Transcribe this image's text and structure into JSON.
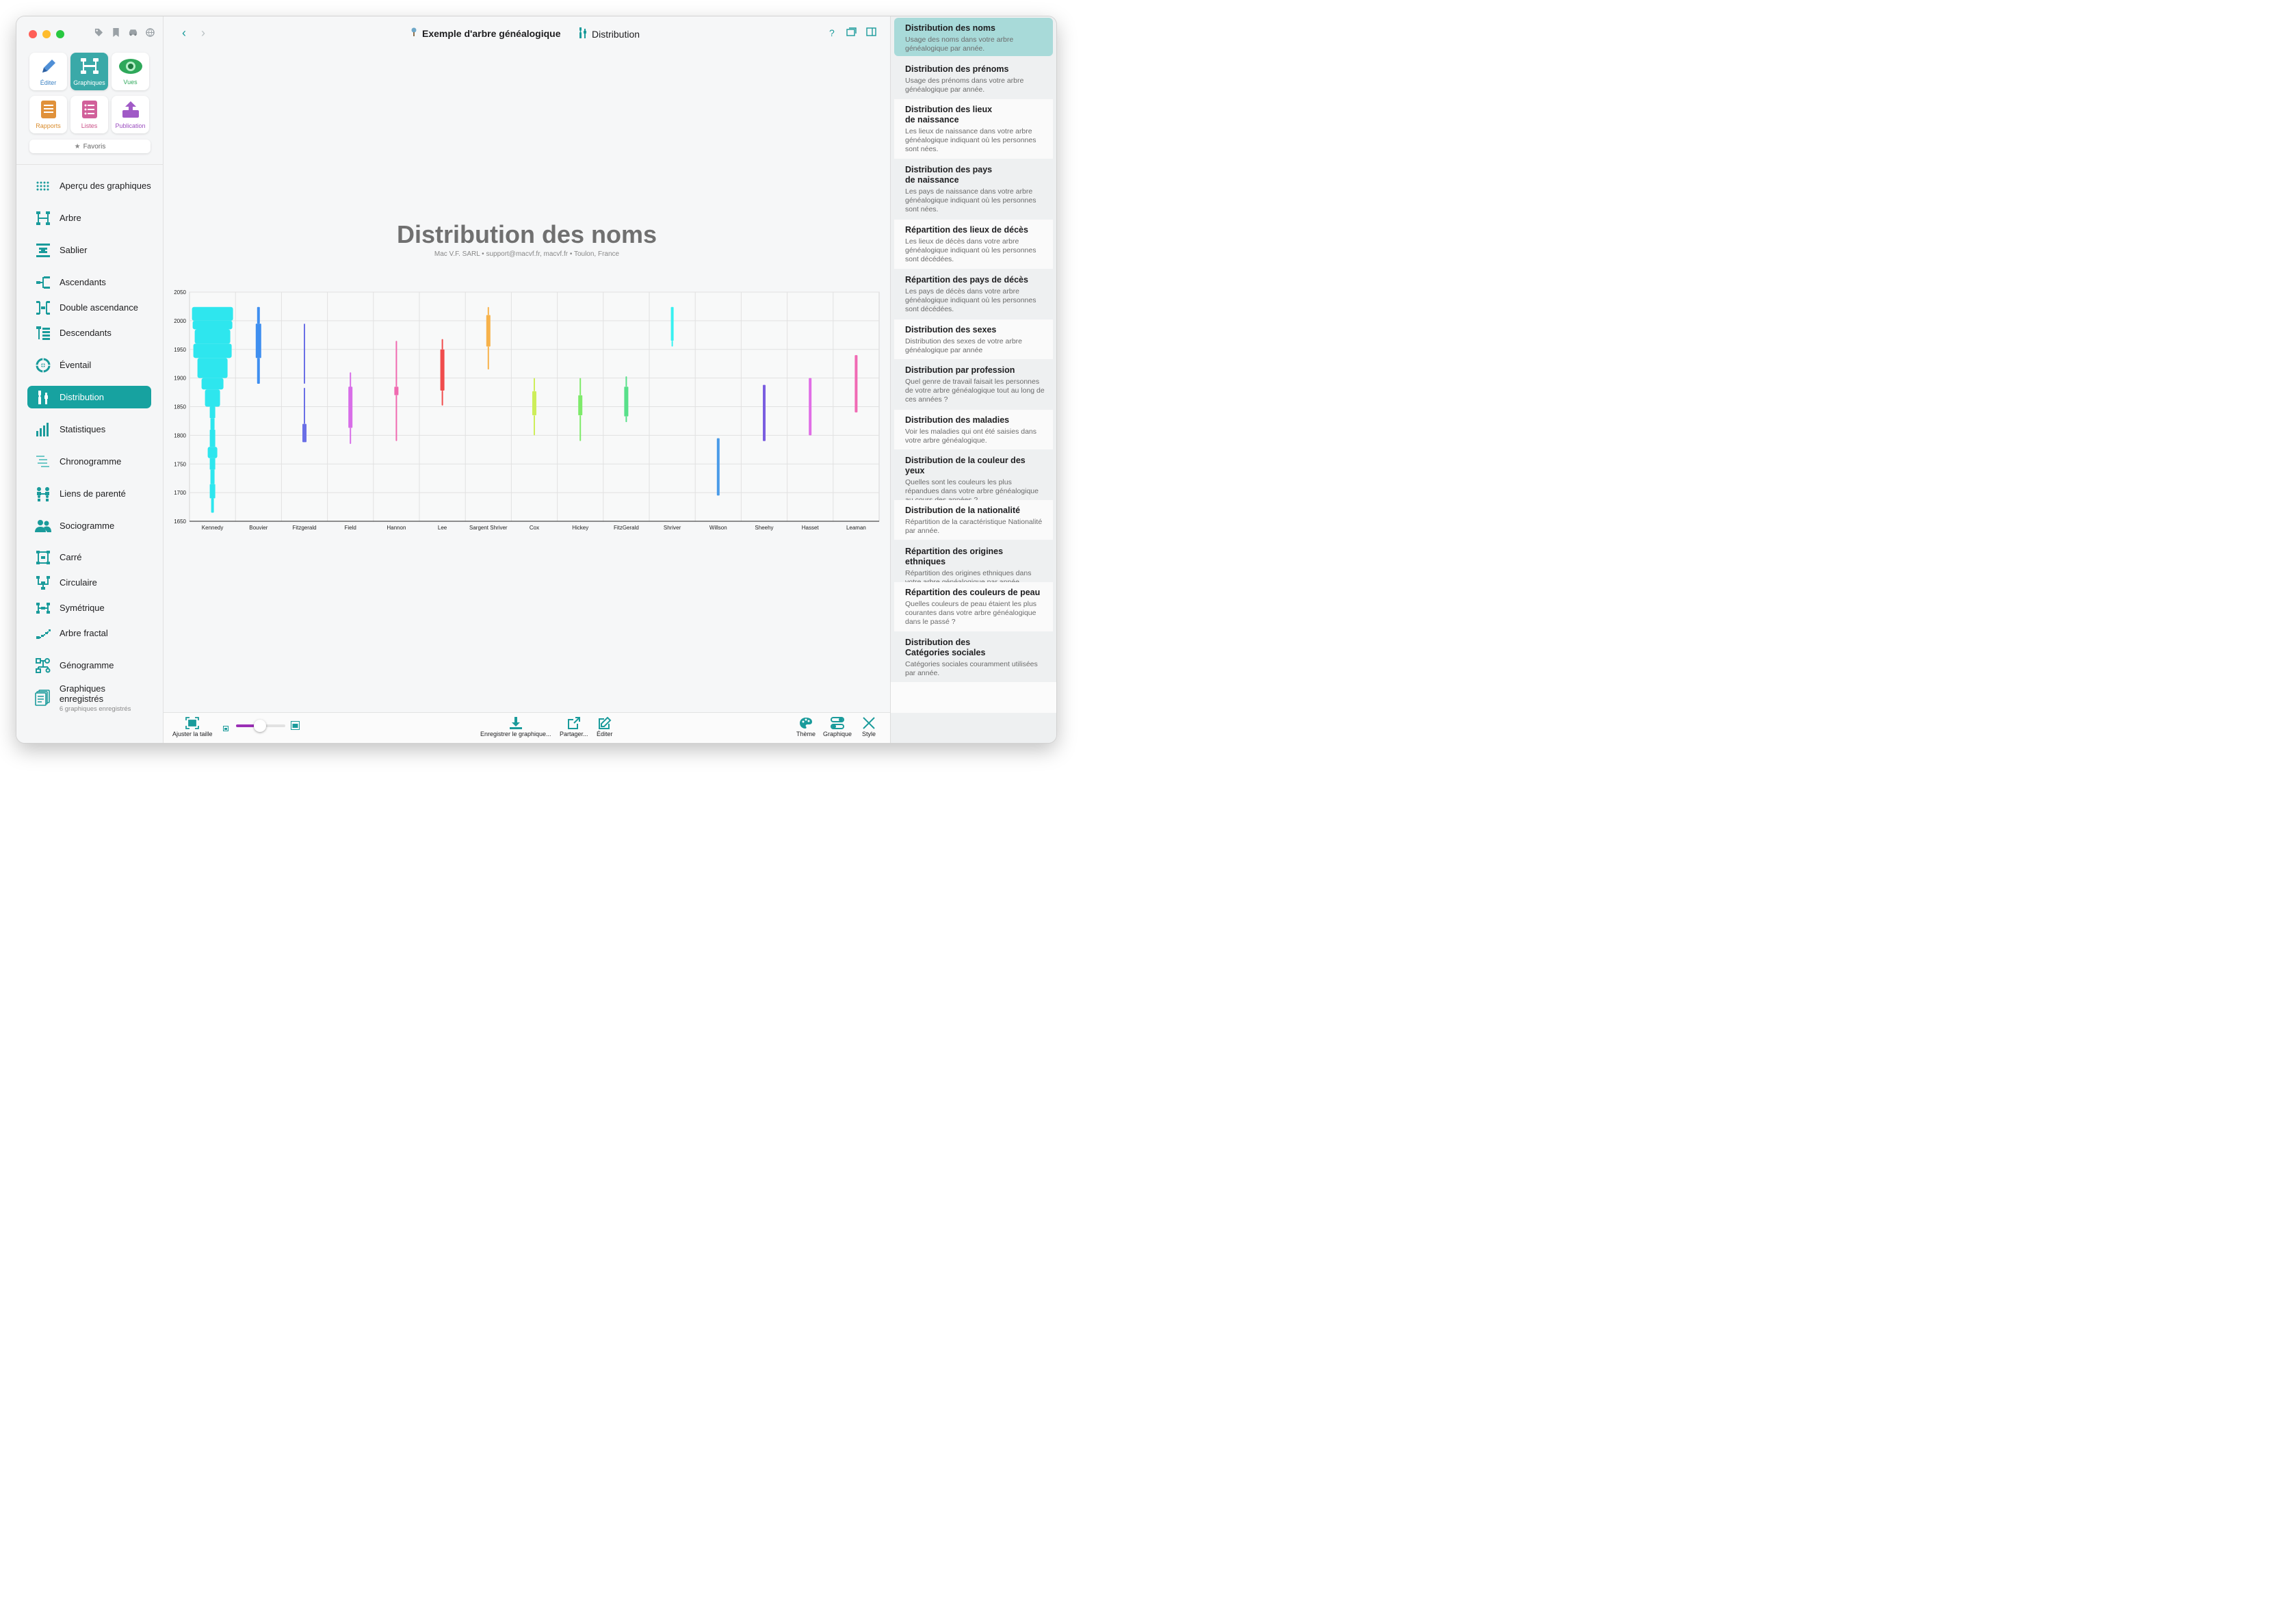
{
  "sidebar": {
    "window_controls_colors": [
      "#ff5f57",
      "#febc2e",
      "#28c840"
    ],
    "toolbar_icons": [
      "tag-icon",
      "bookmark-icon",
      "car-icon",
      "globe-icon"
    ],
    "tools": [
      {
        "label": "Éditer",
        "icon": "pencil-icon",
        "color": "#3b82c4"
      },
      {
        "label": "Graphiques",
        "icon": "chart-tree-icon",
        "color": "#ffffff"
      },
      {
        "label": "Vues",
        "icon": "eye-icon",
        "color": "#2ea85a"
      },
      {
        "label": "Rapports",
        "icon": "report-icon",
        "color": "#d98b2b"
      },
      {
        "label": "Listes",
        "icon": "list-icon",
        "color": "#c94e86"
      },
      {
        "label": "Publication",
        "icon": "upload-icon",
        "color": "#9b4dbf"
      }
    ],
    "favorites_label": "Favoris",
    "nav": [
      {
        "label": "Aperçu des graphiques",
        "icon": "grid-dots-icon"
      },
      {
        "label": "Arbre",
        "icon": "tree-icon"
      },
      {
        "label": "Sablier",
        "icon": "hourglass-icon"
      },
      {
        "label": "Ascendants",
        "icon": "ancestors-icon"
      },
      {
        "label": "Double ascendance",
        "icon": "double-ancestry-icon"
      },
      {
        "label": "Descendants",
        "icon": "descendants-icon"
      },
      {
        "label": "Éventail",
        "icon": "fan-icon"
      },
      {
        "label": "Distribution",
        "icon": "distribution-icon"
      },
      {
        "label": "Statistiques",
        "icon": "statistics-icon"
      },
      {
        "label": "Chronogramme",
        "icon": "timeline-icon"
      },
      {
        "label": "Liens de parenté",
        "icon": "relationship-icon"
      },
      {
        "label": "Sociogramme",
        "icon": "people-icon"
      },
      {
        "label": "Carré",
        "icon": "square-chart-icon"
      },
      {
        "label": "Circulaire",
        "icon": "circular-chart-icon"
      },
      {
        "label": "Symétrique",
        "icon": "symmetric-chart-icon"
      },
      {
        "label": "Arbre fractal",
        "icon": "fractal-tree-icon"
      },
      {
        "label": "Génogramme",
        "icon": "genogram-icon"
      },
      {
        "label": "Graphiques enregistrés",
        "sub": "6 graphiques enregistrés",
        "icon": "saved-charts-icon"
      }
    ],
    "active_nav": "Distribution"
  },
  "topbar": {
    "doc_title": "Exemple d'arbre généalogique",
    "view_title": "Distribution",
    "accent": "#1a9b9b"
  },
  "chart": {
    "title": "Distribution des noms",
    "subtitle": "Mac V.F. SARL • support@macvf.fr, macvf.fr • Toulon, France"
  },
  "chart_data": {
    "type": "violin",
    "title": "Distribution des noms",
    "ylim": [
      1650,
      2050
    ],
    "yticks": [
      1650,
      1700,
      1750,
      1800,
      1850,
      1900,
      1950,
      2000,
      2050
    ],
    "grid": true,
    "categories": [
      "Kennedy",
      "Bouvier",
      "Fitzgerald",
      "Field",
      "Hannon",
      "Lee",
      "Sargent Shriver",
      "Cox",
      "Hickey",
      "FitzGerald",
      "Shriver",
      "Willson",
      "Sheehy",
      "Hasset",
      "Leaman"
    ],
    "series": [
      {
        "colour": "#2ee6ee",
        "segments": [
          [
            2000,
            2024,
            30
          ],
          [
            1985,
            2000,
            29
          ],
          [
            1960,
            1985,
            26
          ],
          [
            1935,
            1960,
            28
          ],
          [
            1900,
            1935,
            22
          ],
          [
            1880,
            1900,
            16
          ],
          [
            1850,
            1880,
            11
          ],
          [
            1830,
            1850,
            4
          ],
          [
            1810,
            1830,
            3
          ],
          [
            1780,
            1810,
            4
          ],
          [
            1760,
            1780,
            7
          ],
          [
            1740,
            1760,
            4
          ],
          [
            1715,
            1740,
            3
          ],
          [
            1690,
            1715,
            4
          ],
          [
            1665,
            1690,
            2
          ]
        ]
      },
      {
        "colour": "#3f8ff0",
        "segments": [
          [
            1995,
            2024,
            2
          ],
          [
            1935,
            1995,
            4
          ],
          [
            1890,
            1935,
            2
          ]
        ]
      },
      {
        "colour": "#6a6fe6",
        "segments": [
          [
            1890,
            1995,
            1
          ],
          [
            1820,
            1883,
            1
          ],
          [
            1788,
            1820,
            3
          ]
        ]
      },
      {
        "colour": "#d86ee8",
        "segments": [
          [
            1865,
            1910,
            1
          ],
          [
            1813,
            1885,
            3
          ],
          [
            1785,
            1813,
            1
          ]
        ]
      },
      {
        "colour": "#f06ab0",
        "segments": [
          [
            1885,
            1965,
            1
          ],
          [
            1870,
            1885,
            3
          ],
          [
            1790,
            1870,
            1
          ]
        ]
      },
      {
        "colour": "#f04c4c",
        "segments": [
          [
            1950,
            1968,
            1
          ],
          [
            1878,
            1950,
            3
          ],
          [
            1852,
            1878,
            1
          ]
        ]
      },
      {
        "colour": "#f7b24a",
        "segments": [
          [
            2010,
            2024,
            1
          ],
          [
            1955,
            2010,
            3
          ],
          [
            1915,
            1955,
            1
          ]
        ]
      },
      {
        "colour": "#cdee5a",
        "segments": [
          [
            1877,
            1900,
            1
          ],
          [
            1835,
            1877,
            3
          ],
          [
            1800,
            1835,
            1
          ]
        ]
      },
      {
        "colour": "#7eea6a",
        "segments": [
          [
            1870,
            1900,
            1
          ],
          [
            1835,
            1870,
            3
          ],
          [
            1790,
            1835,
            1
          ]
        ]
      },
      {
        "colour": "#58e08a",
        "segments": [
          [
            1885,
            1903,
            1
          ],
          [
            1833,
            1885,
            3
          ],
          [
            1823,
            1833,
            1
          ]
        ]
      },
      {
        "colour": "#38f0f0",
        "segments": [
          [
            1965,
            2024,
            2
          ],
          [
            1955,
            1965,
            1
          ]
        ]
      },
      {
        "colour": "#4a9be8",
        "segments": [
          [
            1695,
            1795,
            2
          ]
        ]
      },
      {
        "colour": "#7a5ee0",
        "segments": [
          [
            1790,
            1888,
            2
          ]
        ]
      },
      {
        "colour": "#e06ee6",
        "segments": [
          [
            1800,
            1900,
            2
          ]
        ]
      },
      {
        "colour": "#f06ab4",
        "segments": [
          [
            1840,
            1940,
            2
          ]
        ]
      }
    ]
  },
  "bottombar": {
    "left": [
      {
        "label": "Ajuster la taille",
        "icon": "fit-size-icon"
      }
    ],
    "zoom": {
      "value": 0.48,
      "min_icon": "small-image-icon",
      "max_icon": "large-image-icon",
      "accent": "#9b2fb5"
    },
    "center": [
      {
        "label": "Enregistrer le graphique...",
        "icon": "download-icon"
      },
      {
        "label": "Partager...",
        "icon": "share-icon"
      },
      {
        "label": "Éditer",
        "icon": "edit-icon"
      }
    ],
    "right": [
      {
        "label": "Thème",
        "icon": "palette-icon"
      },
      {
        "label": "Graphique",
        "icon": "toggles-icon"
      },
      {
        "label": "Style",
        "icon": "style-tools-icon"
      }
    ]
  },
  "right_panel": {
    "items": [
      {
        "title": "Distribution des noms",
        "desc": "Usage des noms dans votre arbre généalogique par année."
      },
      {
        "title": "Distribution des prénoms",
        "desc": "Usage des prénoms dans votre arbre généalogique par année."
      },
      {
        "title": "Distribution des lieux\nde naissance",
        "desc": "Les lieux de naissance dans votre arbre généalogique indiquant où les personnes sont nées."
      },
      {
        "title": "Distribution des pays\nde naissance",
        "desc": "Les pays de naissance dans votre arbre généalogique indiquant où les personnes sont nées."
      },
      {
        "title": "Répartition des lieux de décès",
        "desc": "Les lieux de décès dans votre arbre généalogique indiquant où les personnes sont décédées."
      },
      {
        "title": "Répartition des pays de décès",
        "desc": "Les pays de décès dans votre arbre généalogique indiquant où les personnes sont décédées."
      },
      {
        "title": "Distribution des sexes",
        "desc": "Distribution des sexes de votre arbre généalogique par année"
      },
      {
        "title": "Distribution par profession",
        "desc": "Quel genre de travail faisait les personnes de votre arbre généalogique tout au long de ces années ?"
      },
      {
        "title": "Distribution des maladies",
        "desc": "Voir les maladies qui ont été saisies dans votre arbre généalogique."
      },
      {
        "title": "Distribution de la couleur des yeux",
        "desc": "Quelles sont les couleurs les plus répandues dans votre arbre généalogique au cours des années ?"
      },
      {
        "title": "Distribution de la nationalité",
        "desc": "Répartition de la caractéristique Nationalité par année."
      },
      {
        "title": "Répartition des origines ethniques",
        "desc": "Répartition des origines ethniques dans votre arbre généalogique par année."
      },
      {
        "title": "Répartition des couleurs de peau",
        "desc": "Quelles couleurs de peau étaient les plus courantes dans votre arbre généalogique dans le passé ?"
      },
      {
        "title": "Distribution des\nCatégories sociales",
        "desc": "Catégories sociales couramment utilisées par année."
      }
    ]
  }
}
